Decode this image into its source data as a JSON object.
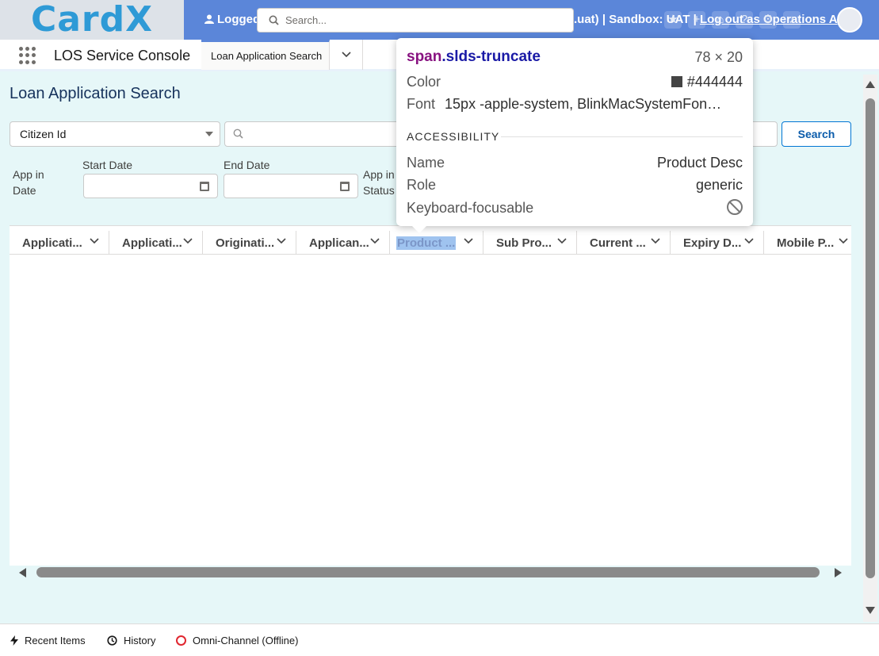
{
  "global_header": {
    "logo": "CardX",
    "logged_text": "Logged",
    "search_placeholder": "Search...",
    "right_text_a": ".uat) | Sandbox: UAT |",
    "right_text_b": "Log out as Operations A",
    "right_text_c": "eve"
  },
  "nav": {
    "app_name": "LOS Service Console",
    "tab_label": "Loan Application Search"
  },
  "main": {
    "page_title": "Loan Application Search",
    "filter_select_value": "Citizen Id",
    "search_button": "Search",
    "labels": {
      "app_in_date": "App in Date",
      "start_date": "Start Date",
      "end_date": "End Date",
      "app_in_status": "App in Status"
    }
  },
  "table": {
    "columns": [
      "Applicati...",
      "Applicati...",
      "Originati...",
      "Applican...",
      "Product ...",
      "Sub Pro...",
      "Current ...",
      "Expiry D...",
      "Mobile P..."
    ]
  },
  "utility_bar": {
    "recent_items": "Recent Items",
    "history": "History",
    "omni_channel": "Omni-Channel (Offline)"
  },
  "inspector": {
    "selector_tag": "span",
    "selector_class": ".slds-truncate",
    "dimensions": "78 × 20",
    "color_label": "Color",
    "color_value": "#444444",
    "font_label": "Font",
    "font_value": "15px -apple-system, BlinkMacSystemFon…",
    "section_title": "ACCESSIBILITY",
    "name_label": "Name",
    "name_value": "Product Desc",
    "role_label": "Role",
    "role_value": "generic",
    "focus_label": "Keyboard-focusable"
  }
}
